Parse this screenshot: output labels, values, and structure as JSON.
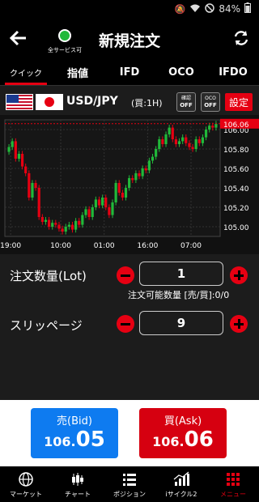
{
  "status_bar": {
    "battery": "84%"
  },
  "header": {
    "title": "新規注文",
    "connection_label": "全サービス可",
    "connection_color": "#21b93a"
  },
  "tabs": [
    {
      "label": "クイック",
      "active": true
    },
    {
      "label": "指値"
    },
    {
      "label": "IFD"
    },
    {
      "label": "OCO"
    },
    {
      "label": "IFDO"
    }
  ],
  "pair": {
    "name": "USD/JPY",
    "timeframe": "(買:1H)",
    "confirm_toggle": {
      "label": "確認",
      "value": "OFF"
    },
    "oco_toggle": {
      "label": "OCO",
      "value": "OFF"
    },
    "settings_label": "設定"
  },
  "chart_data": {
    "type": "candlestick",
    "y_ticks": [
      "106.06",
      "106.00",
      "105.80",
      "105.60",
      "105.40",
      "105.20",
      "105.00"
    ],
    "x_ticks": [
      "19:00",
      "10:00",
      "01:00",
      "16:00",
      "07:00"
    ],
    "current_price": "106.06",
    "ylim": [
      104.9,
      106.1
    ],
    "up_color": "#21b93a",
    "down_color": "#e60012",
    "closes": [
      105.82,
      105.88,
      105.7,
      105.75,
      105.62,
      105.55,
      105.3,
      105.45,
      105.4,
      105.1,
      105.05,
      105.07,
      105.0,
      105.04,
      105.02,
      104.98,
      104.95,
      105.0,
      105.02,
      104.97,
      105.06,
      105.02,
      105.12,
      105.18,
      105.1,
      105.2,
      105.28,
      105.22,
      105.3,
      105.2,
      105.12,
      105.25,
      105.45,
      105.35,
      105.3,
      105.4,
      105.5,
      105.48,
      105.55,
      105.52,
      105.6,
      105.58,
      105.68,
      105.72,
      105.8,
      105.9,
      105.85,
      105.95,
      106.02,
      105.9,
      105.85,
      105.88,
      105.92,
      105.86,
      105.82,
      105.8,
      105.9,
      105.86,
      105.92,
      106.0,
      106.04,
      106.02,
      106.06
    ]
  },
  "order": {
    "quantity_label": "注文数量(Lot)",
    "quantity_value": "1",
    "available_quantity": "注文可能数量 [売/買]:0/0",
    "slippage_label": "スリッページ",
    "slippage_value": "9"
  },
  "prices": {
    "bid_label": "売(Bid)",
    "bid_main": "106.",
    "bid_pips": "05",
    "ask_label": "買(Ask)",
    "ask_main": "106.",
    "ask_pips": "06",
    "bid_color": "#0e7bf0",
    "ask_color": "#d60010"
  },
  "bottom_nav": [
    {
      "label": "マーケット",
      "icon": "globe-icon"
    },
    {
      "label": "チャート",
      "icon": "candlestick-icon"
    },
    {
      "label": "ポジション",
      "icon": "list-icon"
    },
    {
      "label": "iサイクル2",
      "icon": "bar-chart-icon"
    },
    {
      "label": "メニュー",
      "icon": "grid-menu-icon",
      "active": true
    }
  ]
}
